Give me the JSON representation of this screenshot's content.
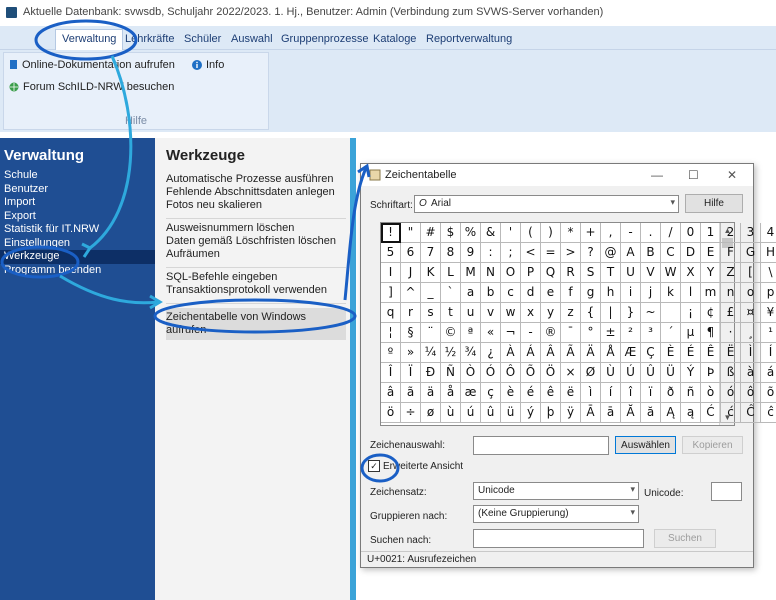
{
  "window_title": "Aktuelle Datenbank: svwsdb, Schuljahr 2022/2023. 1. Hj., Benutzer: Admin (Verbindung zum SVWS-Server vorhanden)",
  "ribbon": {
    "tabs": [
      "Verwaltung",
      "Lehrkräfte",
      "Schüler",
      "Auswahl",
      "Gruppenprozesse",
      "Kataloge",
      "Reportverwaltung"
    ],
    "active_tab": "Verwaltung",
    "buttons": {
      "online_doc": "Online-Dokumentation aufrufen",
      "info": "Info",
      "forum": "Forum SchILD-NRW besuchen"
    },
    "group_label": "Hilfe"
  },
  "leftnav": {
    "title": "Verwaltung",
    "items": [
      "Schule",
      "Benutzer",
      "Import",
      "Export",
      "Statistik für IT.NRW",
      "Einstellungen",
      "Werkzeuge",
      "Programm beenden"
    ],
    "active": "Werkzeuge"
  },
  "middle": {
    "title": "Werkzeuge",
    "groups": [
      [
        "Automatische Prozesse ausführen",
        "Fehlende Abschnittsdaten anlegen",
        "Fotos neu skalieren"
      ],
      [
        "Ausweisnummern löschen",
        "Daten gemäß Löschfristen löschen",
        "Aufräumen"
      ],
      [
        "SQL-Befehle eingeben",
        "Transaktionsprotokoll verwenden"
      ],
      [
        "Zeichentabelle von Windows aufrufen"
      ]
    ]
  },
  "dialog": {
    "title": "Zeichentabelle",
    "controls": {
      "minimize": "—",
      "maximize": "☐",
      "close": "✕"
    },
    "font_label": "Schriftart:",
    "font_value": "Arial",
    "font_icon": "O",
    "help_button": "Hilfe",
    "chars": [
      [
        "!",
        "\"",
        "#",
        "$",
        "%",
        "&",
        "'",
        "(",
        ")",
        "*",
        "+",
        ",",
        "-",
        ".",
        "/",
        "0",
        "1",
        "2",
        "3",
        "4"
      ],
      [
        "5",
        "6",
        "7",
        "8",
        "9",
        ":",
        ";",
        "<",
        "=",
        ">",
        "?",
        "@",
        "A",
        "B",
        "C",
        "D",
        "E",
        "F",
        "G",
        "H"
      ],
      [
        "I",
        "J",
        "K",
        "L",
        "M",
        "N",
        "O",
        "P",
        "Q",
        "R",
        "S",
        "T",
        "U",
        "V",
        "W",
        "X",
        "Y",
        "Z",
        "[",
        "\\"
      ],
      [
        "]",
        "^",
        "_",
        "`",
        "a",
        "b",
        "c",
        "d",
        "e",
        "f",
        "g",
        "h",
        "i",
        "j",
        "k",
        "l",
        "m",
        "n",
        "o",
        "p"
      ],
      [
        "q",
        "r",
        "s",
        "t",
        "u",
        "v",
        "w",
        "x",
        "y",
        "z",
        "{",
        "|",
        "}",
        "~",
        " ",
        "¡",
        "¢",
        "£",
        "¤",
        "¥"
      ],
      [
        "¦",
        "§",
        "¨",
        "©",
        "ª",
        "«",
        "¬",
        "-",
        "®",
        "¯",
        "°",
        "±",
        "²",
        "³",
        "´",
        "µ",
        "¶",
        "·",
        "¸",
        "¹"
      ],
      [
        "º",
        "»",
        "¼",
        "½",
        "¾",
        "¿",
        "À",
        "Á",
        "Â",
        "Ã",
        "Ä",
        "Å",
        "Æ",
        "Ç",
        "È",
        "É",
        "Ê",
        "Ë",
        "Ì",
        "Í"
      ],
      [
        "Î",
        "Ï",
        "Ð",
        "Ñ",
        "Ò",
        "Ó",
        "Ô",
        "Õ",
        "Ö",
        "×",
        "Ø",
        "Ù",
        "Ú",
        "Û",
        "Ü",
        "Ý",
        "Þ",
        "ß",
        "à",
        "á"
      ],
      [
        "â",
        "ã",
        "ä",
        "å",
        "æ",
        "ç",
        "è",
        "é",
        "ê",
        "ë",
        "ì",
        "í",
        "î",
        "ï",
        "ð",
        "ñ",
        "ò",
        "ó",
        "ô",
        "õ"
      ],
      [
        "ö",
        "÷",
        "ø",
        "ù",
        "ú",
        "û",
        "ü",
        "ý",
        "þ",
        "ÿ",
        "Ā",
        "ā",
        "Ă",
        "ă",
        "Ą",
        "ą",
        "Ć",
        "ć",
        "Ĉ",
        "ĉ"
      ]
    ],
    "selected_char": "!",
    "zeichenauswahl_label": "Zeichenauswahl:",
    "auswaehlen_button": "Auswählen",
    "kopieren_button": "Kopieren",
    "erweiterte_ansicht": "Erweiterte Ansicht",
    "erweiterte_ansicht_checked": true,
    "zeichensatz_label": "Zeichensatz:",
    "zeichensatz_value": "Unicode",
    "unicode_label": "Unicode:",
    "gruppieren_label": "Gruppieren nach:",
    "gruppieren_value": "(Keine Gruppierung)",
    "suchen_label": "Suchen nach:",
    "suchen_button": "Suchen",
    "status": "U+0021: Ausrufezeichen"
  },
  "colors": {
    "accent_nav": "#1f4e93",
    "annotation": "#1a6fd0",
    "splitter": "#3ba3d8"
  }
}
